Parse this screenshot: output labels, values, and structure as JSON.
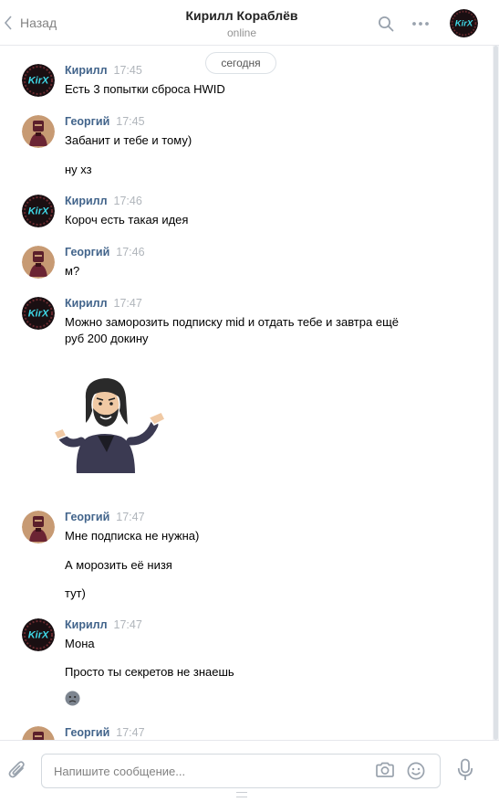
{
  "header": {
    "back_label": "Назад",
    "title": "Кирилл Кораблёв",
    "status": "online"
  },
  "date_separator": "сегодня",
  "avatars": {
    "kirill_text": "KirX"
  },
  "messages": [
    {
      "author": "Кирилл",
      "time": "17:45",
      "lines": [
        "Есть 3 попытки сброса HWID"
      ]
    },
    {
      "author": "Георгий",
      "time": "17:45",
      "lines": [
        "Забанит и тебе и тому)",
        "ну хз"
      ]
    },
    {
      "author": "Кирилл",
      "time": "17:46",
      "lines": [
        "Короч есть такая идея"
      ]
    },
    {
      "author": "Георгий",
      "time": "17:46",
      "lines": [
        "м?"
      ]
    },
    {
      "author": "Кирилл",
      "time": "17:47",
      "lines": [
        "Можно заморозить подписку mid и отдать тебе и завтра ещё",
        "руб 200 докину"
      ],
      "sticker": "shrugging-man-sticker"
    },
    {
      "author": "Георгий",
      "time": "17:47",
      "lines": [
        "Мне подписка не нужна)",
        "А морозить её низя",
        "тут)"
      ]
    },
    {
      "author": "Кирилл",
      "time": "17:47",
      "lines": [
        "Мона",
        "Просто ты секретов не знаешь"
      ],
      "emoji": "sad-face-emoji"
    },
    {
      "author": "Георгий",
      "time": "17:47",
      "lines": []
    }
  ],
  "composer": {
    "placeholder": "Напишите сообщение..."
  },
  "colors": {
    "author": "#42648b",
    "time": "#b0b5bb",
    "kirill_avatar_bg": "#1a0f12",
    "kirill_avatar_text": "#3fd9e8",
    "georgiy_avatar_bg": "#c79a73"
  }
}
